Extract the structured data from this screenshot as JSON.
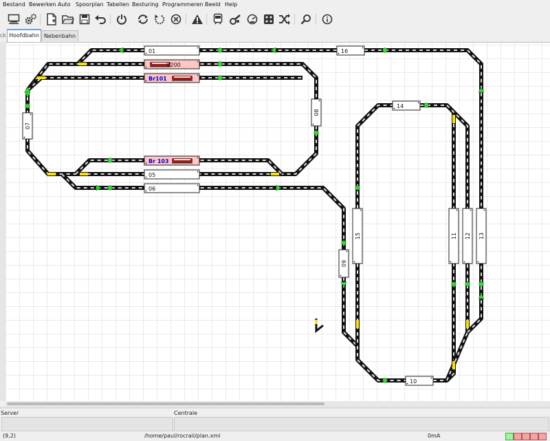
{
  "menu": [
    "Bestand",
    "Bewerken",
    "Auto",
    "Spoorplan",
    "Tabellen",
    "Besturing",
    "Programmeren",
    "Beeld",
    "Help"
  ],
  "toolbar": {
    "icons": [
      "monitor-icon",
      "gears-icon",
      "new-file-icon",
      "open-folder-icon",
      "save-icon",
      "undo-icon",
      "power-icon",
      "sync-icon",
      "rotate-icon",
      "cancel-icon",
      "warning-icon",
      "train-icon",
      "loco-throttle-icon",
      "gauge-icon",
      "dice-icon",
      "shuffle-icon",
      "search-icon",
      "info-icon"
    ]
  },
  "tabs": [
    {
      "label": "Hoofdbahn",
      "active": true
    },
    {
      "label": "Nebenbahn",
      "active": false
    }
  ],
  "tab_left_fragment": "ck",
  "colors": {
    "track_rail": "#111111",
    "track_tie_light": "#dddddd",
    "sensor": "#33dd33",
    "occupied": "#ffc6c6",
    "loco_label": "#0000cc",
    "signal_yellow": "#ffe000"
  },
  "blocks": [
    {
      "id": "01",
      "label": "01",
      "loco": false
    },
    {
      "id": "v200",
      "label": "V200",
      "loco": true
    },
    {
      "id": "br101",
      "label": "Br101",
      "loco": true
    },
    {
      "id": "br103",
      "label": "Br 103",
      "loco": true
    },
    {
      "id": "05",
      "label": "05",
      "loco": false
    },
    {
      "id": "06",
      "label": "06",
      "loco": false
    },
    {
      "id": "16",
      "label": "16",
      "loco": false
    },
    {
      "id": "14",
      "label": "14",
      "loco": false
    },
    {
      "id": "10",
      "label": "10",
      "loco": false
    },
    {
      "id": "07",
      "label": "07",
      "loco": false
    },
    {
      "id": "08",
      "label": "08",
      "loco": false
    },
    {
      "id": "09",
      "label": "09",
      "loco": false
    },
    {
      "id": "15",
      "label": "15",
      "loco": false
    },
    {
      "id": "11",
      "label": "11",
      "loco": false
    },
    {
      "id": "12",
      "label": "12",
      "loco": false
    },
    {
      "id": "13",
      "label": "13",
      "loco": false
    }
  ],
  "panels": {
    "server_label": "Server",
    "centrale_label": "Centrale"
  },
  "status": {
    "coords": "(9,2)",
    "path": "/home/paul/rocrail/plan.xml",
    "current": "0mA"
  }
}
